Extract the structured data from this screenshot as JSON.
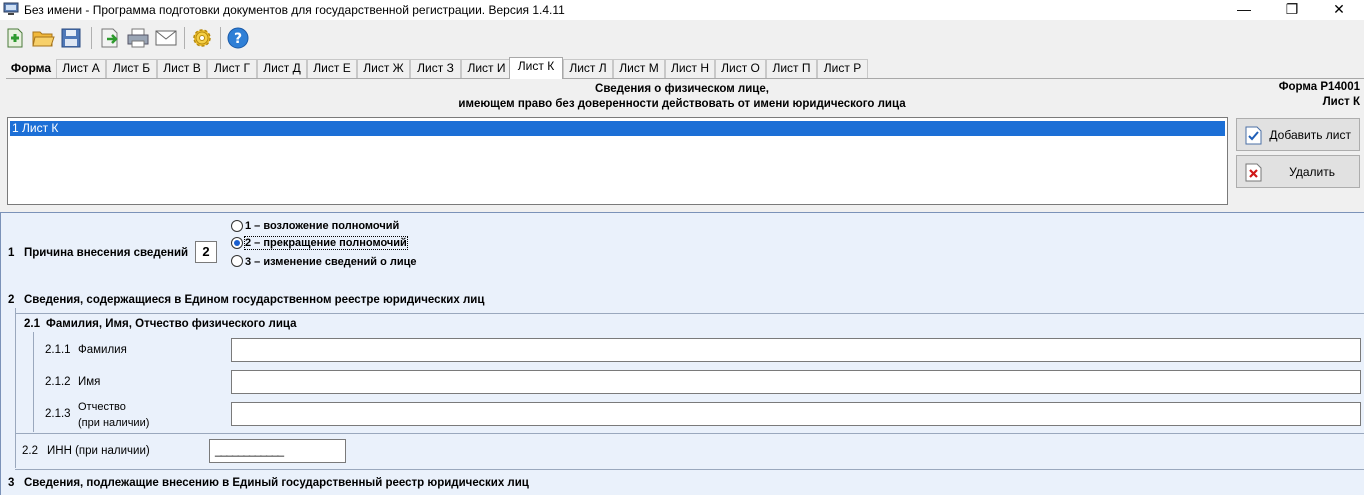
{
  "window": {
    "title": "Без имени - Программа подготовки документов для государственной регистрации. Версия 1.4.11",
    "minimize": "—",
    "maximize": "❐",
    "close": "✕"
  },
  "toolbar": {
    "buttons": [
      "new-document-icon",
      "open-folder-icon",
      "save-disk-icon",
      "export-icon",
      "print-icon",
      "mail-icon",
      "settings-gear-icon",
      "help-icon"
    ]
  },
  "tabs": [
    "Форма",
    "Лист А",
    "Лист Б",
    "Лист В",
    "Лист Г",
    "Лист Д",
    "Лист Е",
    "Лист Ж",
    "Лист З",
    "Лист И",
    "Лист К",
    "Лист Л",
    "Лист М",
    "Лист Н",
    "Лист О",
    "Лист П",
    "Лист Р"
  ],
  "active_tab": "Лист К",
  "header": {
    "line1": "Сведения о физическом лице,",
    "line2": "имеющем право без доверенности действовать от имени юридического лица",
    "form_code": "Форма Р14001",
    "sheet_code": "Лист К"
  },
  "sheets_list": {
    "items": [
      "1 Лист К"
    ],
    "add_label": "Добавить лист",
    "delete_label": "Удалить"
  },
  "section1": {
    "num": "1",
    "label": "Причина внесения сведений",
    "value": "2",
    "options": [
      "1 – возложение полномочий",
      "2 – прекращение полномочий",
      "3 – изменение сведений о лице"
    ],
    "selected": 2
  },
  "section2": {
    "num": "2",
    "label": "Сведения, содержащиеся в Едином государственном реестре юридических лиц",
    "sub21": {
      "num": "2.1",
      "label": "Фамилия, Имя, Отчество физического лица",
      "lastname_num": "2.1.1",
      "lastname_label": "Фамилия",
      "lastname_value": "",
      "firstname_num": "2.1.2",
      "firstname_label": "Имя",
      "firstname_value": "",
      "patronymic_num": "2.1.3",
      "patronymic_label1": "Отчество",
      "patronymic_label2": "(при наличии)",
      "patronymic_value": ""
    },
    "sub22": {
      "num": "2.2",
      "label": "ИНН (при наличии)",
      "mask": "____________"
    }
  },
  "section3": {
    "num": "3",
    "label": "Сведения, подлежащие внесению в Единый государственный реестр юридических лиц"
  }
}
